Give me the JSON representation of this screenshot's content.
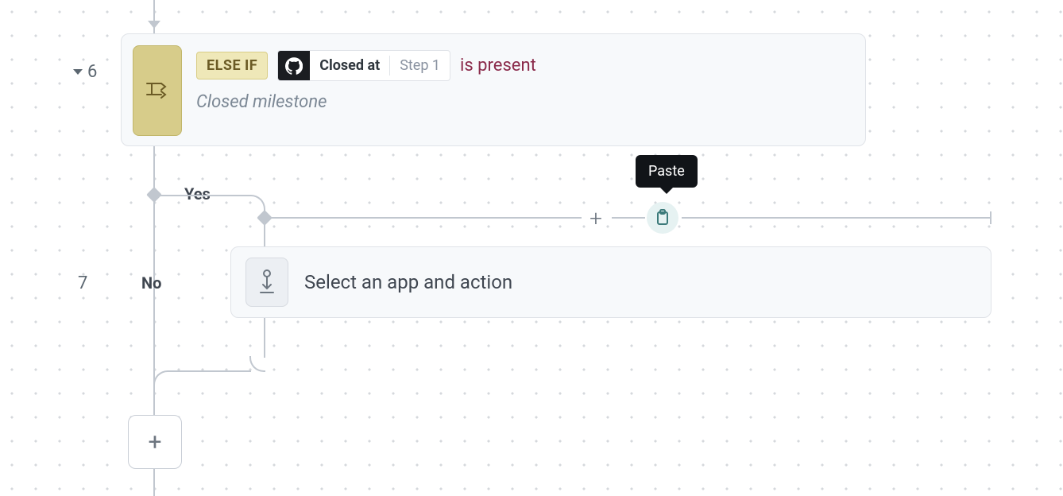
{
  "steps": {
    "six_number": "6",
    "seven_number": "7"
  },
  "card6": {
    "elseif_tag": "ELSE IF",
    "pill_field": "Closed at",
    "pill_step": "Step 1",
    "operator": "is present",
    "description": "Closed milestone"
  },
  "branch": {
    "yes": "Yes",
    "no": "No"
  },
  "card7": {
    "title": "Select an app and action"
  },
  "tooltip": {
    "paste": "Paste"
  },
  "icons": {
    "branch": "branch-icon",
    "github": "github-icon",
    "action_placeholder": "action-placeholder-icon",
    "plus": "plus-icon",
    "paste": "paste-icon"
  }
}
